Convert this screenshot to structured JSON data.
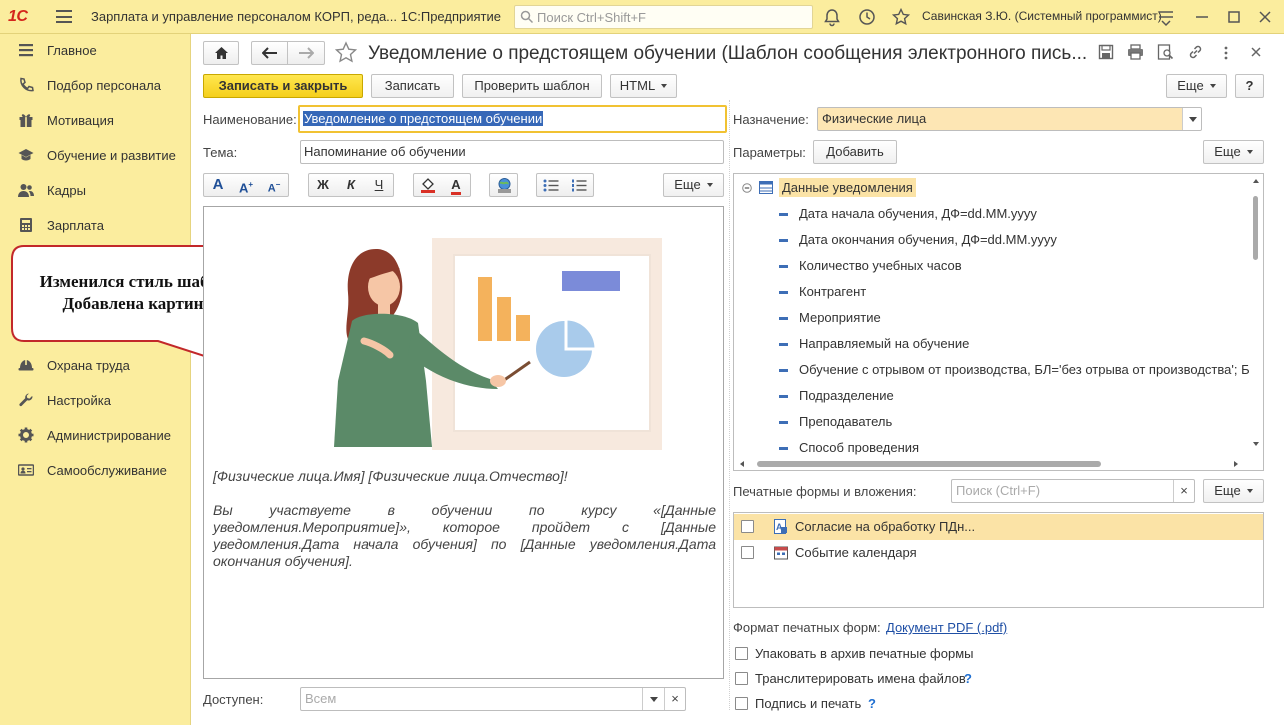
{
  "titlebar": {
    "logo": "1С",
    "app_title": "Зарплата и управление персоналом КОРП, реда...  1С:Предприятие",
    "search_placeholder": "Поиск Ctrl+Shift+F",
    "user_name": "Савинская З.Ю. (Системный программист)"
  },
  "sidebar": {
    "items": [
      {
        "label": "Главное",
        "icon": "list-icon"
      },
      {
        "label": "Подбор персонала",
        "icon": "phone-icon"
      },
      {
        "label": "Мотивация",
        "icon": "gift-icon"
      },
      {
        "label": "Обучение и развитие",
        "icon": "graduation-icon"
      },
      {
        "label": "Кадры",
        "icon": "people-icon"
      },
      {
        "label": "Зарплата",
        "icon": "calculator-icon"
      },
      {
        "label": "Охрана труда",
        "icon": "helmet-icon"
      },
      {
        "label": "Настройка",
        "icon": "wrench-icon"
      },
      {
        "label": "Администрирование",
        "icon": "gear-icon"
      },
      {
        "label": "Самообслуживание",
        "icon": "id-card-icon"
      }
    ]
  },
  "callout": {
    "line1": "Изменился стиль шаблона",
    "line2": "Добавлена картинка"
  },
  "form": {
    "title": "Уведомление о предстоящем обучении (Шаблон сообщения электронного пись...",
    "buttons": {
      "save_close": "Записать и закрыть",
      "save": "Записать",
      "check_template": "Проверить шаблон",
      "html": "HTML",
      "more": "Еще",
      "help": "?",
      "add": "Добавить"
    },
    "name_label": "Наименование:",
    "name_value": "Уведомление о предстоящем обучении",
    "subject_label": "Тема:",
    "subject_value": "Напоминание об обучении",
    "purpose_label": "Назначение:",
    "purpose_value": "Физические лица",
    "params_label": "Параметры:",
    "format_toolbar": {
      "font": "A",
      "font_grow": "A",
      "font_shrink": "A",
      "bold": "Ж",
      "italic": "К",
      "underline": "Ч",
      "text_color": "A"
    },
    "editor": {
      "greeting": "[Физические лица.Имя] [Физические лица.Отчество]!",
      "body": "Вы участвуете в обучении по курсу «[Данные уведомления.Мероприятие]», которое пройдет с [Данные уведомления.Дата начала обучения] по [Данные уведомления.Дата окончания обучения]."
    },
    "available_label": "Доступен:",
    "available_placeholder": "Всем",
    "params_tree": {
      "root": "Данные уведомления",
      "items": [
        "Дата начала обучения, ДФ=dd.MM.yyyy",
        "Дата окончания обучения, ДФ=dd.MM.yyyy",
        "Количество учебных часов",
        "Контрагент",
        "Мероприятие",
        "Направляемый на обучение",
        "Обучение с отрывом от производства, БЛ='без отрыва от производства'; Б",
        "Подразделение",
        "Преподаватель",
        "Способ проведения"
      ]
    },
    "print_forms_label": "Печатные формы и вложения:",
    "print_search_placeholder": "Поиск (Ctrl+F)",
    "print_forms": [
      {
        "label": "Согласие на обработку ПДн...",
        "checked": false,
        "selected": true
      },
      {
        "label": "Событие календаря",
        "checked": false,
        "selected": false
      }
    ],
    "format_label": "Формат печатных форм:",
    "format_value": "Документ PDF (.pdf)",
    "options": [
      {
        "label": "Упаковать в архив печатные формы",
        "checked": false,
        "help": ""
      },
      {
        "label": "Транслитерировать имена файлов",
        "checked": false,
        "help": "?"
      },
      {
        "label": "Подпись и печать",
        "checked": false,
        "help": "?"
      }
    ]
  },
  "colors": {
    "header_bg": "#fbed9e",
    "primary_button": "#f5cf1c",
    "selection": "#fbe3a6",
    "link": "#1f4fa5"
  }
}
